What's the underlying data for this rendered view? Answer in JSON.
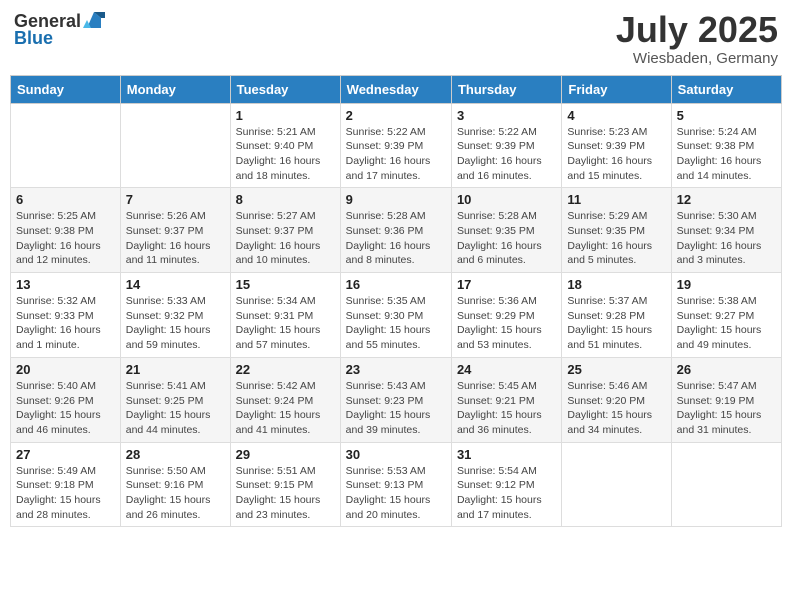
{
  "header": {
    "logo_general": "General",
    "logo_blue": "Blue",
    "month_title": "July 2025",
    "subtitle": "Wiesbaden, Germany"
  },
  "weekdays": [
    "Sunday",
    "Monday",
    "Tuesday",
    "Wednesday",
    "Thursday",
    "Friday",
    "Saturday"
  ],
  "weeks": [
    [
      {
        "day": "",
        "info": ""
      },
      {
        "day": "",
        "info": ""
      },
      {
        "day": "1",
        "info": "Sunrise: 5:21 AM\nSunset: 9:40 PM\nDaylight: 16 hours and 18 minutes."
      },
      {
        "day": "2",
        "info": "Sunrise: 5:22 AM\nSunset: 9:39 PM\nDaylight: 16 hours and 17 minutes."
      },
      {
        "day": "3",
        "info": "Sunrise: 5:22 AM\nSunset: 9:39 PM\nDaylight: 16 hours and 16 minutes."
      },
      {
        "day": "4",
        "info": "Sunrise: 5:23 AM\nSunset: 9:39 PM\nDaylight: 16 hours and 15 minutes."
      },
      {
        "day": "5",
        "info": "Sunrise: 5:24 AM\nSunset: 9:38 PM\nDaylight: 16 hours and 14 minutes."
      }
    ],
    [
      {
        "day": "6",
        "info": "Sunrise: 5:25 AM\nSunset: 9:38 PM\nDaylight: 16 hours and 12 minutes."
      },
      {
        "day": "7",
        "info": "Sunrise: 5:26 AM\nSunset: 9:37 PM\nDaylight: 16 hours and 11 minutes."
      },
      {
        "day": "8",
        "info": "Sunrise: 5:27 AM\nSunset: 9:37 PM\nDaylight: 16 hours and 10 minutes."
      },
      {
        "day": "9",
        "info": "Sunrise: 5:28 AM\nSunset: 9:36 PM\nDaylight: 16 hours and 8 minutes."
      },
      {
        "day": "10",
        "info": "Sunrise: 5:28 AM\nSunset: 9:35 PM\nDaylight: 16 hours and 6 minutes."
      },
      {
        "day": "11",
        "info": "Sunrise: 5:29 AM\nSunset: 9:35 PM\nDaylight: 16 hours and 5 minutes."
      },
      {
        "day": "12",
        "info": "Sunrise: 5:30 AM\nSunset: 9:34 PM\nDaylight: 16 hours and 3 minutes."
      }
    ],
    [
      {
        "day": "13",
        "info": "Sunrise: 5:32 AM\nSunset: 9:33 PM\nDaylight: 16 hours and 1 minute."
      },
      {
        "day": "14",
        "info": "Sunrise: 5:33 AM\nSunset: 9:32 PM\nDaylight: 15 hours and 59 minutes."
      },
      {
        "day": "15",
        "info": "Sunrise: 5:34 AM\nSunset: 9:31 PM\nDaylight: 15 hours and 57 minutes."
      },
      {
        "day": "16",
        "info": "Sunrise: 5:35 AM\nSunset: 9:30 PM\nDaylight: 15 hours and 55 minutes."
      },
      {
        "day": "17",
        "info": "Sunrise: 5:36 AM\nSunset: 9:29 PM\nDaylight: 15 hours and 53 minutes."
      },
      {
        "day": "18",
        "info": "Sunrise: 5:37 AM\nSunset: 9:28 PM\nDaylight: 15 hours and 51 minutes."
      },
      {
        "day": "19",
        "info": "Sunrise: 5:38 AM\nSunset: 9:27 PM\nDaylight: 15 hours and 49 minutes."
      }
    ],
    [
      {
        "day": "20",
        "info": "Sunrise: 5:40 AM\nSunset: 9:26 PM\nDaylight: 15 hours and 46 minutes."
      },
      {
        "day": "21",
        "info": "Sunrise: 5:41 AM\nSunset: 9:25 PM\nDaylight: 15 hours and 44 minutes."
      },
      {
        "day": "22",
        "info": "Sunrise: 5:42 AM\nSunset: 9:24 PM\nDaylight: 15 hours and 41 minutes."
      },
      {
        "day": "23",
        "info": "Sunrise: 5:43 AM\nSunset: 9:23 PM\nDaylight: 15 hours and 39 minutes."
      },
      {
        "day": "24",
        "info": "Sunrise: 5:45 AM\nSunset: 9:21 PM\nDaylight: 15 hours and 36 minutes."
      },
      {
        "day": "25",
        "info": "Sunrise: 5:46 AM\nSunset: 9:20 PM\nDaylight: 15 hours and 34 minutes."
      },
      {
        "day": "26",
        "info": "Sunrise: 5:47 AM\nSunset: 9:19 PM\nDaylight: 15 hours and 31 minutes."
      }
    ],
    [
      {
        "day": "27",
        "info": "Sunrise: 5:49 AM\nSunset: 9:18 PM\nDaylight: 15 hours and 28 minutes."
      },
      {
        "day": "28",
        "info": "Sunrise: 5:50 AM\nSunset: 9:16 PM\nDaylight: 15 hours and 26 minutes."
      },
      {
        "day": "29",
        "info": "Sunrise: 5:51 AM\nSunset: 9:15 PM\nDaylight: 15 hours and 23 minutes."
      },
      {
        "day": "30",
        "info": "Sunrise: 5:53 AM\nSunset: 9:13 PM\nDaylight: 15 hours and 20 minutes."
      },
      {
        "day": "31",
        "info": "Sunrise: 5:54 AM\nSunset: 9:12 PM\nDaylight: 15 hours and 17 minutes."
      },
      {
        "day": "",
        "info": ""
      },
      {
        "day": "",
        "info": ""
      }
    ]
  ]
}
